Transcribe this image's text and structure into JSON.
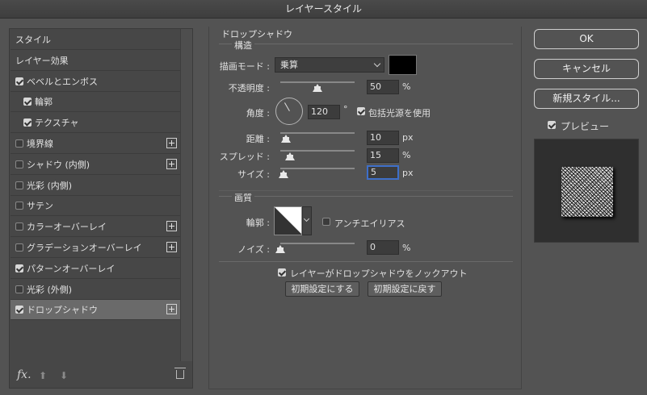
{
  "window": {
    "title": "レイヤースタイル"
  },
  "styles_list": [
    {
      "label": "スタイル",
      "checkbox": null,
      "plus": false,
      "selected": false
    },
    {
      "label": "レイヤー効果",
      "checkbox": null,
      "plus": false,
      "selected": false
    },
    {
      "label": "ベベルとエンボス",
      "checkbox": true,
      "plus": false,
      "selected": false
    },
    {
      "label": "輪郭",
      "checkbox": true,
      "plus": false,
      "selected": false,
      "indent": true
    },
    {
      "label": "テクスチャ",
      "checkbox": true,
      "plus": false,
      "selected": false,
      "indent": true
    },
    {
      "label": "境界線",
      "checkbox": false,
      "plus": true,
      "selected": false
    },
    {
      "label": "シャドウ (内側)",
      "checkbox": false,
      "plus": true,
      "selected": false
    },
    {
      "label": "光彩 (内側)",
      "checkbox": false,
      "plus": false,
      "selected": false
    },
    {
      "label": "サテン",
      "checkbox": false,
      "plus": false,
      "selected": false
    },
    {
      "label": "カラーオーバーレイ",
      "checkbox": false,
      "plus": true,
      "selected": false
    },
    {
      "label": "グラデーションオーバーレイ",
      "checkbox": false,
      "plus": true,
      "selected": false
    },
    {
      "label": "パターンオーバーレイ",
      "checkbox": true,
      "plus": false,
      "selected": false
    },
    {
      "label": "光彩 (外側)",
      "checkbox": false,
      "plus": false,
      "selected": false
    },
    {
      "label": "ドロップシャドウ",
      "checkbox": true,
      "plus": true,
      "selected": true
    }
  ],
  "footer": {
    "fx_label": "fx."
  },
  "drop_shadow": {
    "section_title": "ドロップシャドウ",
    "structure_title": "構造",
    "blend_mode_label": "描画モード :",
    "blend_mode_value": "乗算",
    "blend_color": "#000000",
    "opacity_label": "不透明度 :",
    "opacity_value": "50",
    "opacity_unit": "%",
    "opacity_level": 0.5,
    "angle_label": "角度 :",
    "angle_value": "120",
    "angle_unit": "°",
    "global_light_label": "包括光源を使用",
    "global_light_checked": true,
    "distance_label": "距離 :",
    "distance_value": "10",
    "distance_unit": "px",
    "spread_label": "スプレッド :",
    "spread_value": "15",
    "spread_unit": "%",
    "size_label": "サイズ :",
    "size_value": "5",
    "size_unit": "px",
    "quality_title": "画質",
    "contour_label": "輪郭 :",
    "antialias_label": "アンチエイリアス",
    "antialias_checked": false,
    "noise_label": "ノイズ :",
    "noise_value": "0",
    "noise_unit": "%",
    "knockout_label": "レイヤーがドロップシャドウをノックアウト",
    "knockout_checked": true,
    "make_default_label": "初期設定にする",
    "reset_default_label": "初期設定に戻す"
  },
  "right_panel": {
    "ok_label": "OK",
    "cancel_label": "キャンセル",
    "new_style_label": "新規スタイル...",
    "preview_label": "プレビュー",
    "preview_checked": true
  }
}
